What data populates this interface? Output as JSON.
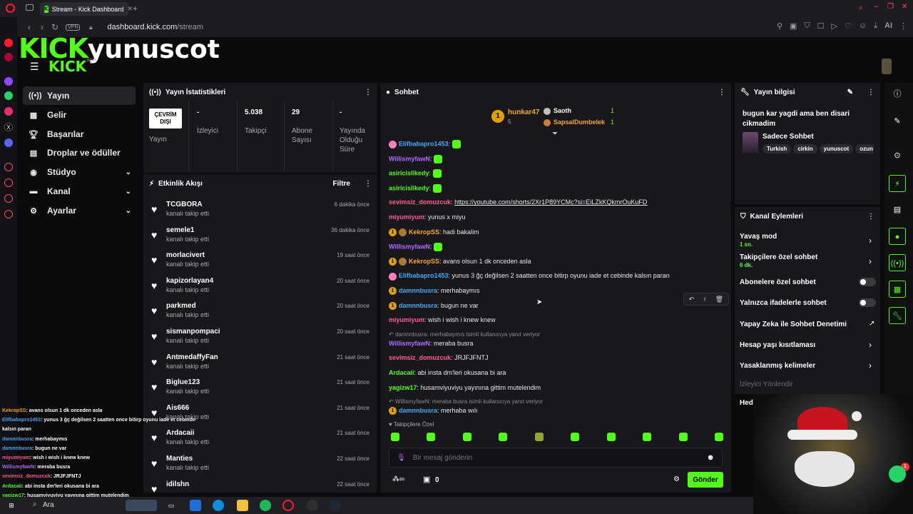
{
  "browser": {
    "tab_title": "Stream - Kick Dashboard",
    "vpn": "VPN",
    "url_domain": "dashboard.kick.com",
    "url_path": "/stream",
    "ai_label": "AI"
  },
  "brand": {
    "logo": "KICK",
    "channel_name": "yunuscot",
    "logo_small": "KICK",
    "beta": "BETA"
  },
  "nav": [
    {
      "label": "Yayın",
      "icon": "broadcast-icon",
      "active": true
    },
    {
      "label": "Gelir",
      "icon": "revenue-icon"
    },
    {
      "label": "Başarılar",
      "icon": "trophy-icon"
    },
    {
      "label": "Droplar ve ödüller",
      "icon": "gift-icon"
    },
    {
      "label": "Stüdyo",
      "icon": "studio-icon",
      "expandable": true
    },
    {
      "label": "Kanal",
      "icon": "channel-icon",
      "expandable": true
    },
    {
      "label": "Ayarlar",
      "icon": "gear-icon",
      "expandable": true
    }
  ],
  "stats": {
    "title": "Yayın İstatistikleri",
    "status": "ÇEVRİM DIŞI",
    "status_label": "Yayın",
    "viewers": {
      "value": "-",
      "label": "İzleyici"
    },
    "followers": {
      "value": "5.038",
      "label": "Takipçi"
    },
    "subs": {
      "value": "29",
      "label": "Abone Sayısı"
    },
    "uptime": {
      "value": "-",
      "label": "Yayında Olduğu Süre"
    }
  },
  "activity": {
    "title": "Etkinlik Akışı",
    "filter": "Filtre",
    "items": [
      {
        "user": "TCGBORA",
        "desc": "kanalı takip etti",
        "time": "6 dakika önce"
      },
      {
        "user": "semele1",
        "desc": "kanalı takip etti",
        "time": "36 dakika önce"
      },
      {
        "user": "morlacivert",
        "desc": "kanalı takip etti",
        "time": "19 saat önce"
      },
      {
        "user": "kapizorlayan4",
        "desc": "kanalı takip etti",
        "time": "20 saat önce"
      },
      {
        "user": "parkmed",
        "desc": "kanalı takip etti",
        "time": "20 saat önce"
      },
      {
        "user": "sismanpompaci",
        "desc": "kanalı takip etti",
        "time": "20 saat önce"
      },
      {
        "user": "AntmedaffyFan",
        "desc": "kanalı takip etti",
        "time": "21 saat önce"
      },
      {
        "user": "Biglue123",
        "desc": "kanalı takip etti",
        "time": "21 saat önce"
      },
      {
        "user": "Ais666",
        "desc": "kanalı takip etti",
        "time": "21 saat önce"
      },
      {
        "user": "Ardacaii",
        "desc": "kanalı takip etti",
        "time": "21 saat önce"
      },
      {
        "user": "Manties",
        "desc": "kanalı takip etti",
        "time": "22 saat önce"
      },
      {
        "user": "idilshn",
        "desc": "",
        "time": "22 saat önce"
      }
    ]
  },
  "chat": {
    "title": "Sohbet",
    "leaders": [
      {
        "name": "hunkar47",
        "count": "5"
      },
      {
        "name": "Saoth",
        "count": "1"
      },
      {
        "name": "SapsalDumbelek",
        "count": "1"
      }
    ],
    "messages": [
      {
        "user": "Elifbabapro1453",
        "color": "#3fa9f5",
        "text": "",
        "badge": "pink",
        "emote": true
      },
      {
        "user": "WillismyfawN",
        "color": "#b06bff",
        "text": "",
        "emote": true
      },
      {
        "user": "asiricislikedy",
        "color": "#53fc18",
        "text": "",
        "emote": true
      },
      {
        "user": "asiricislikedy",
        "color": "#53fc18",
        "text": "",
        "emote": true
      },
      {
        "user": "sevimsiz_domuzcuk",
        "color": "#ff5b8d",
        "text": "https://youtube.com/shorts/2Xr1P89YCMc?si=EiLZkKQkmrOuKuFD",
        "link": true
      },
      {
        "user": "miyumiyum",
        "color": "#ff5b8d",
        "text": "yunus x miyu"
      },
      {
        "user": "KekropSS",
        "color": "#f5a623",
        "text": "hadi bakalim",
        "badge": "gold",
        "badge2": true
      },
      {
        "user": "WillismyfawN",
        "color": "#b06bff",
        "text": "",
        "emote": true
      },
      {
        "user": "KekropSS",
        "color": "#f5a623",
        "text": "avans olsun 1 dk onceden asla",
        "badge": "gold",
        "badge2": true
      },
      {
        "user": "Elifbabapro1453",
        "color": "#3fa9f5",
        "text": "yunus 3 ğç değilsen 2 saatten once bitirp oyunu iade et cebinde kalsın paran",
        "badge": "pink"
      },
      {
        "user": "damnnbusra",
        "color": "#3fa9f5",
        "text": "merhabaymıs",
        "badge": "gold"
      },
      {
        "user": "damnnbusra",
        "color": "#3fa9f5",
        "text": "bugun ne var",
        "badge": "gold"
      },
      {
        "user": "miyumiyum",
        "color": "#ff5b8d",
        "text": "wish i wish i knew knew"
      },
      {
        "user": "WillismyfawN",
        "color": "#b06bff",
        "text": "meraba busra",
        "reply": "damnnbusra: merhabaymıs isimli kullanıcıya yanıt veriyor"
      },
      {
        "user": "sevimsiz_domuzcuk",
        "color": "#ff5b8d",
        "text": "JRJFJFNTJ"
      },
      {
        "user": "Ardacaii",
        "color": "#53fc18",
        "text": "abi insta dm'leri okusana bi ara"
      },
      {
        "user": "yagizw17",
        "color": "#53fc18",
        "text": "husamviyuviyu yayınına gittim mutelendim"
      },
      {
        "user": "damnnbusra",
        "color": "#3fa9f5",
        "text": "merhaba wılı",
        "badge": "gold",
        "reply": "WillismyfawN: meraba busra isimli kullanıcıya yanıt veriyor"
      }
    ],
    "follower_only": "Takipçilere Özel",
    "input_placeholder": "Bir mesaj gönderin",
    "points": "0",
    "send": "Gönder"
  },
  "stream_info": {
    "title": "Yayın bilgisi",
    "stream_title": "bugun kar yagdi ama ben disari cikmadim",
    "category": "Sadece Sohbet",
    "tags": [
      "Turkish",
      "cirkin",
      "yunuscot",
      "ozun"
    ]
  },
  "channel_actions": {
    "title": "Kanal Eylemleri",
    "items": [
      {
        "label": "Yavaş mod",
        "sub": "1 sn.",
        "type": "chevron"
      },
      {
        "label": "Takipçilere özel sohbet",
        "sub": "6 dk.",
        "type": "chevron"
      },
      {
        "label": "Abonelere özel sohbet",
        "type": "toggle"
      },
      {
        "label": "Yalnızca ifadelerle sohbet",
        "type": "toggle"
      },
      {
        "label": "Yapay Zeka ile Sohbet Denetimi",
        "type": "external"
      },
      {
        "label": "Hesap yaşı kısıtlaması",
        "type": "chevron"
      },
      {
        "label": "Yasaklanmış kelimeler",
        "type": "chevron"
      },
      {
        "label": "İzleyici Yönlendir",
        "type": "disabled"
      },
      {
        "label": "Hed",
        "type": "none"
      }
    ]
  },
  "overlay_chat": [
    {
      "user": "KekropSS",
      "text": ": avans olsun 1 dk onceden asla"
    },
    {
      "user": "Elifbabapro1453",
      "text": ": yunus 3 ğç değilsen 2 saatten once bitirp oyunu iade et cebinde"
    },
    {
      "user": "",
      "text": "kalsın paran"
    },
    {
      "user": "damnnbusra",
      "text": ": merhabaymıs"
    },
    {
      "user": "damnnbusra",
      "text": ": bugun ne var"
    },
    {
      "user": "miyumiyum",
      "text": ": wish i wish i knew knew"
    },
    {
      "user": "WillismyfawN",
      "text": ": meraba busra"
    },
    {
      "user": "sevimsiz_domuzcuk",
      "text": ": JRJFJFNTJ"
    },
    {
      "user": "Ardacaii",
      "text": ": abi insta dm'leri okusana bi ara"
    },
    {
      "user": "yagizw17",
      "text": ": husamviyuviyu yayınına gittim mutelendim"
    },
    {
      "user": "damnnbusra",
      "text": ": merhaba wılı"
    }
  ],
  "taskbar": {
    "search": "Ara"
  },
  "notification_count": "1"
}
